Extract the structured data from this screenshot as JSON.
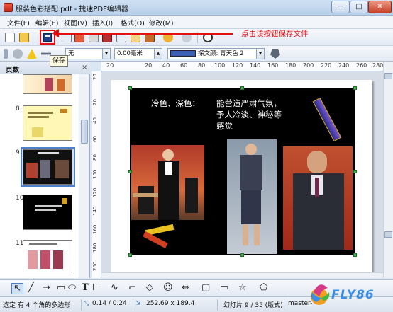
{
  "window": {
    "title": "服装色彩搭配.pdf - 捷速PDF编辑器",
    "minimize": "─",
    "maximize": "□",
    "close": "✕"
  },
  "menu": [
    {
      "id": "file",
      "label": "文件(F)"
    },
    {
      "id": "edit",
      "label": "编辑(E)"
    },
    {
      "id": "view",
      "label": "视图(V)"
    },
    {
      "id": "insert",
      "label": "插入(I)"
    },
    {
      "id": "format",
      "label": "格式(O)"
    },
    {
      "id": "modify",
      "label": "修改(M)"
    }
  ],
  "annotation": {
    "text": "点击该按钮保存文件",
    "color": "#e01010"
  },
  "tooltip": {
    "text": "保存"
  },
  "toolbar2": {
    "line_style": "无",
    "line_width": "0.00毫米",
    "fill_label": "探文颜: 青天色 2",
    "fill_color": "#3a5fb0"
  },
  "pages_panel": {
    "title": "页数",
    "close": "×",
    "pages": [
      {
        "number": "",
        "selected": false
      },
      {
        "number": "8",
        "selected": false
      },
      {
        "number": "9",
        "selected": true
      },
      {
        "number": "10",
        "selected": false
      },
      {
        "number": "11",
        "selected": false
      }
    ]
  },
  "ruler": {
    "h_labels": [
      "20",
      "20",
      "40",
      "60",
      "80",
      "100",
      "120",
      "140",
      "160",
      "180",
      "200",
      "220",
      "240",
      "260",
      "280"
    ],
    "v_labels": [
      "20",
      "20",
      "40",
      "60",
      "80",
      "100",
      "120",
      "140",
      "160",
      "180",
      "200"
    ]
  },
  "slide": {
    "heading": "冷色、深色：",
    "body_lines": [
      "能营造严肃气氛，",
      "予人冷淡、神秘等",
      "感觉"
    ]
  },
  "drawing_tools": [
    "select",
    "line",
    "arrow",
    "rectangle",
    "ellipse",
    "text",
    "connector",
    "curve",
    "polygon",
    "basic-shapes",
    "symbol-shapes",
    "block-arrows",
    "flowchart",
    "callouts",
    "stars",
    "3d-objects"
  ],
  "statusbar": {
    "selection": "选定 有 4 个角的多边形",
    "position": "0.14 / 0.24",
    "size": "252.69 x 189.4",
    "slide": "幻灯片 9 / 35 (版式)",
    "master": "master-"
  },
  "watermark": {
    "text": "FLY86"
  }
}
